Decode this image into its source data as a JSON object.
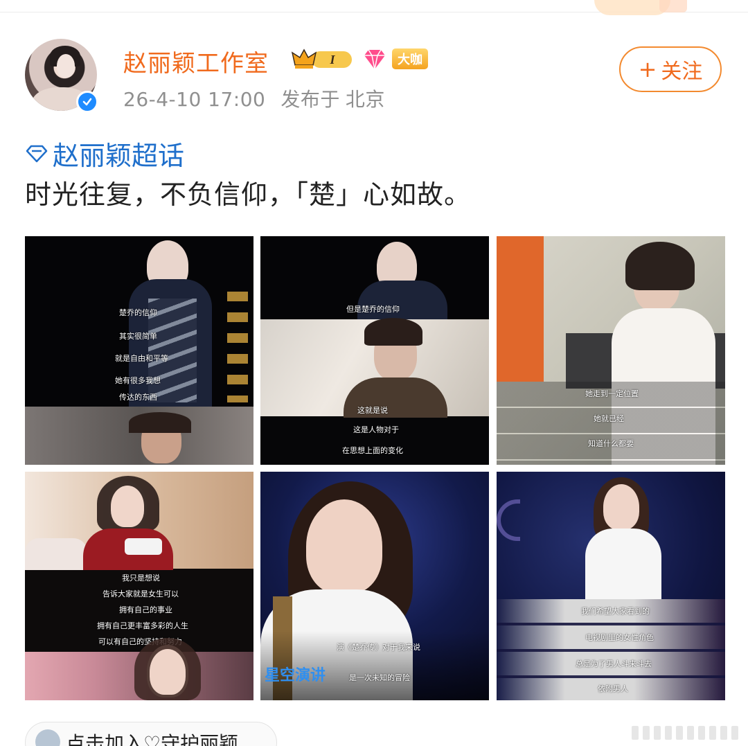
{
  "header": {
    "name": "赵丽颖工作室",
    "badge_level": "I",
    "badge_daka": "大咖",
    "timestamp": "26-4-10 17:00",
    "location_prefix": "发布于",
    "location": "北京",
    "follow_label": "关注",
    "follow_plus": "+"
  },
  "post": {
    "topic": "赵丽颖超话",
    "text": "时光往复，不负信仰，「楚」心如故。"
  },
  "images": [
    {
      "captions": [
        "楚乔的信仰",
        "其实很简单",
        "就是自由和平等",
        "她有很多我想",
        "传达的东西"
      ]
    },
    {
      "captions": [
        "但是楚乔的信仰",
        "这就是说",
        "这是人物对于",
        "在思想上面的变化"
      ]
    },
    {
      "captions": [
        "她走到一定位置",
        "她就已经",
        "知道什么都要"
      ]
    },
    {
      "captions": [
        "我只是想说",
        "告诉大家就是女生可以",
        "拥有自己的事业",
        "拥有自己更丰富多彩的人生",
        "可以有自己的坚持和努力"
      ]
    },
    {
      "captions": [
        "演《楚乔传》对于我来说",
        "是一次未知的冒险"
      ],
      "logo": "星空演讲"
    },
    {
      "captions": [
        "我们希望大家看到的",
        "电视剧里的女性角色",
        "总是为了男人斗来斗去",
        "依附男人"
      ]
    }
  ],
  "bottom": {
    "pill_text": "点击加入♡守护丽颖"
  },
  "colors": {
    "accent": "#f06a1d",
    "topic": "#1f6fcb",
    "meta": "#8f8f8f"
  }
}
